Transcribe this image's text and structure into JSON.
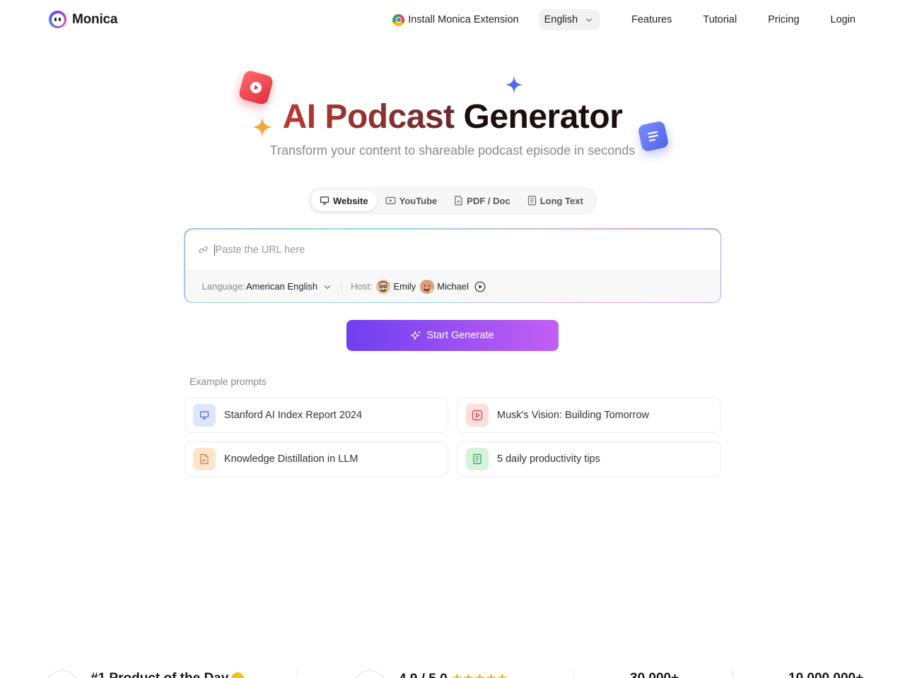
{
  "header": {
    "brand": "Monica",
    "install_label": "Install Monica Extension",
    "language": "English",
    "nav": [
      "Features",
      "Tutorial",
      "Pricing",
      "Login"
    ]
  },
  "hero": {
    "title_part1": "AI Podcast",
    "title_part2": "Generator",
    "subtitle": "Transform your content to shareable podcast episode in seconds"
  },
  "tabs": [
    {
      "label": "Website",
      "icon": "monitor-icon",
      "active": true
    },
    {
      "label": "YouTube",
      "icon": "youtube-icon",
      "active": false
    },
    {
      "label": "PDF / Doc",
      "icon": "file-icon",
      "active": false
    },
    {
      "label": "Long Text",
      "icon": "text-doc-icon",
      "active": false
    }
  ],
  "input": {
    "placeholder": "Paste the URL here",
    "value": "",
    "language_label": "Language:",
    "language_value": "American English",
    "host_label": "Host:",
    "hosts": [
      "Emily",
      "Michael"
    ]
  },
  "generate_label": "Start Generate",
  "examples": {
    "title": "Example prompts",
    "items": [
      {
        "label": "Stanford AI Index Report 2024",
        "icon": "monitor-icon",
        "color": "#dde6fb"
      },
      {
        "label": "Musk's Vision: Building Tomorrow",
        "icon": "youtube-icon",
        "color": "#fbdede"
      },
      {
        "label": "Knowledge Distillation in LLM",
        "icon": "pdf-image-icon",
        "color": "#fde5cc"
      },
      {
        "label": "5 daily productivity tips",
        "icon": "text-doc-icon",
        "color": "#d6f3dc"
      }
    ]
  },
  "stats": {
    "product_of_day": "#1 Product of the Day",
    "rating": "4.9 / 5.0",
    "stars": "★★★★★",
    "count1": "30,000+",
    "count2": "10,000,000+"
  },
  "colors": {
    "accent_start": "#6e3ff0",
    "accent_end": "#c35ff3",
    "title_red": "#b93a32"
  }
}
